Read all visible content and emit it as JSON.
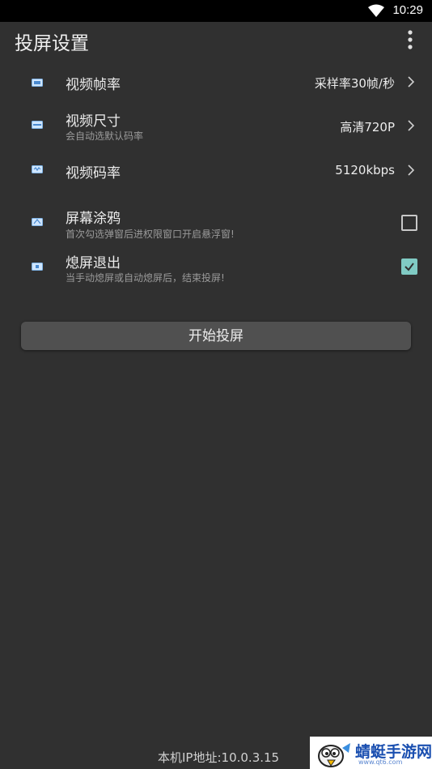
{
  "status": {
    "time": "10:29"
  },
  "appbar": {
    "title": "投屏设置"
  },
  "settings": [
    {
      "label": "视频帧率",
      "value": "采样率30帧/秒"
    },
    {
      "label": "视频尺寸",
      "sub": "会自动选默认码率",
      "value": "高清720P"
    },
    {
      "label": "视频码率",
      "value": "5120kbps"
    }
  ],
  "toggles": [
    {
      "label": "屏幕涂鸦",
      "sub": "首次勾选弹窗后进权限窗口开启悬浮窗!",
      "checked": false
    },
    {
      "label": "熄屏退出",
      "sub": "当手动熄屏或自动熄屏后，结束投屏!",
      "checked": true
    }
  ],
  "start_button": {
    "label": "开始投屏"
  },
  "footer": {
    "ip": "本机IP地址:10.0.3.15"
  },
  "watermark": {
    "text": "蜻蜓手游网",
    "url": "www.qt6.com"
  },
  "colors": {
    "background": "#303030",
    "accent": "#80cbc4",
    "button": "#505050"
  }
}
